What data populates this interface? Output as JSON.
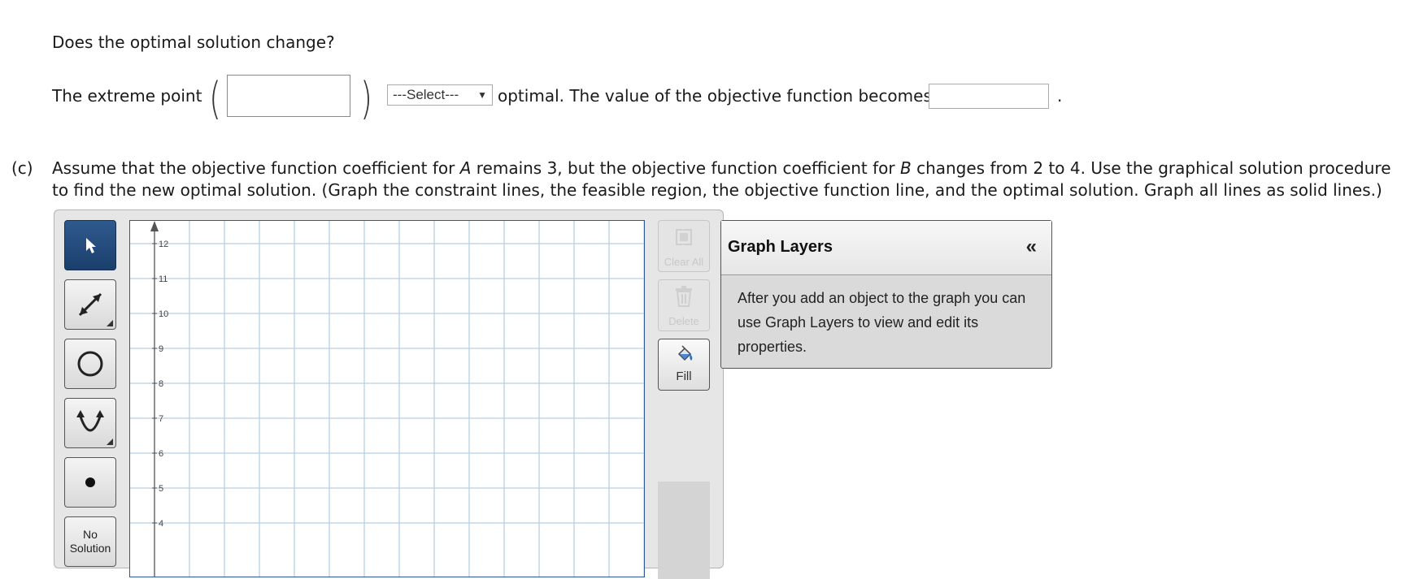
{
  "question1": "Does the optimal solution change?",
  "row2": {
    "extreme_point_label": "The extreme point",
    "paren_left": "(",
    "paren_right": ")",
    "select_value": "---Select---",
    "select_arrow": "▼",
    "optimal_text": "optimal. The value of the objective function becomes",
    "period": "."
  },
  "part_c": {
    "marker": "(c)",
    "text_a": "Assume that the objective function coefficient for ",
    "var_a": "A",
    "text_b": " remains 3, but the objective function coefficient for ",
    "var_b": "B",
    "text_c": " changes from 2 to 4. Use the graphical solution procedure to find the new optimal solution. (Graph the constraint lines, the feasible region, the objective function line, and the optimal solution. Graph all lines as solid lines.)"
  },
  "tools": {
    "no_solution_line1": "No",
    "no_solution_line2": "Solution"
  },
  "graph": {
    "y_ticks": [
      "12",
      "11",
      "10",
      "9",
      "8",
      "7",
      "6",
      "5",
      "4"
    ]
  },
  "right_buttons": {
    "clear_all": "Clear All",
    "delete": "Delete",
    "fill": "Fill"
  },
  "layers": {
    "title": "Graph Layers",
    "collapse": "«",
    "description": "After you add an object to the graph you can use Graph Layers to view and edit its properties."
  }
}
